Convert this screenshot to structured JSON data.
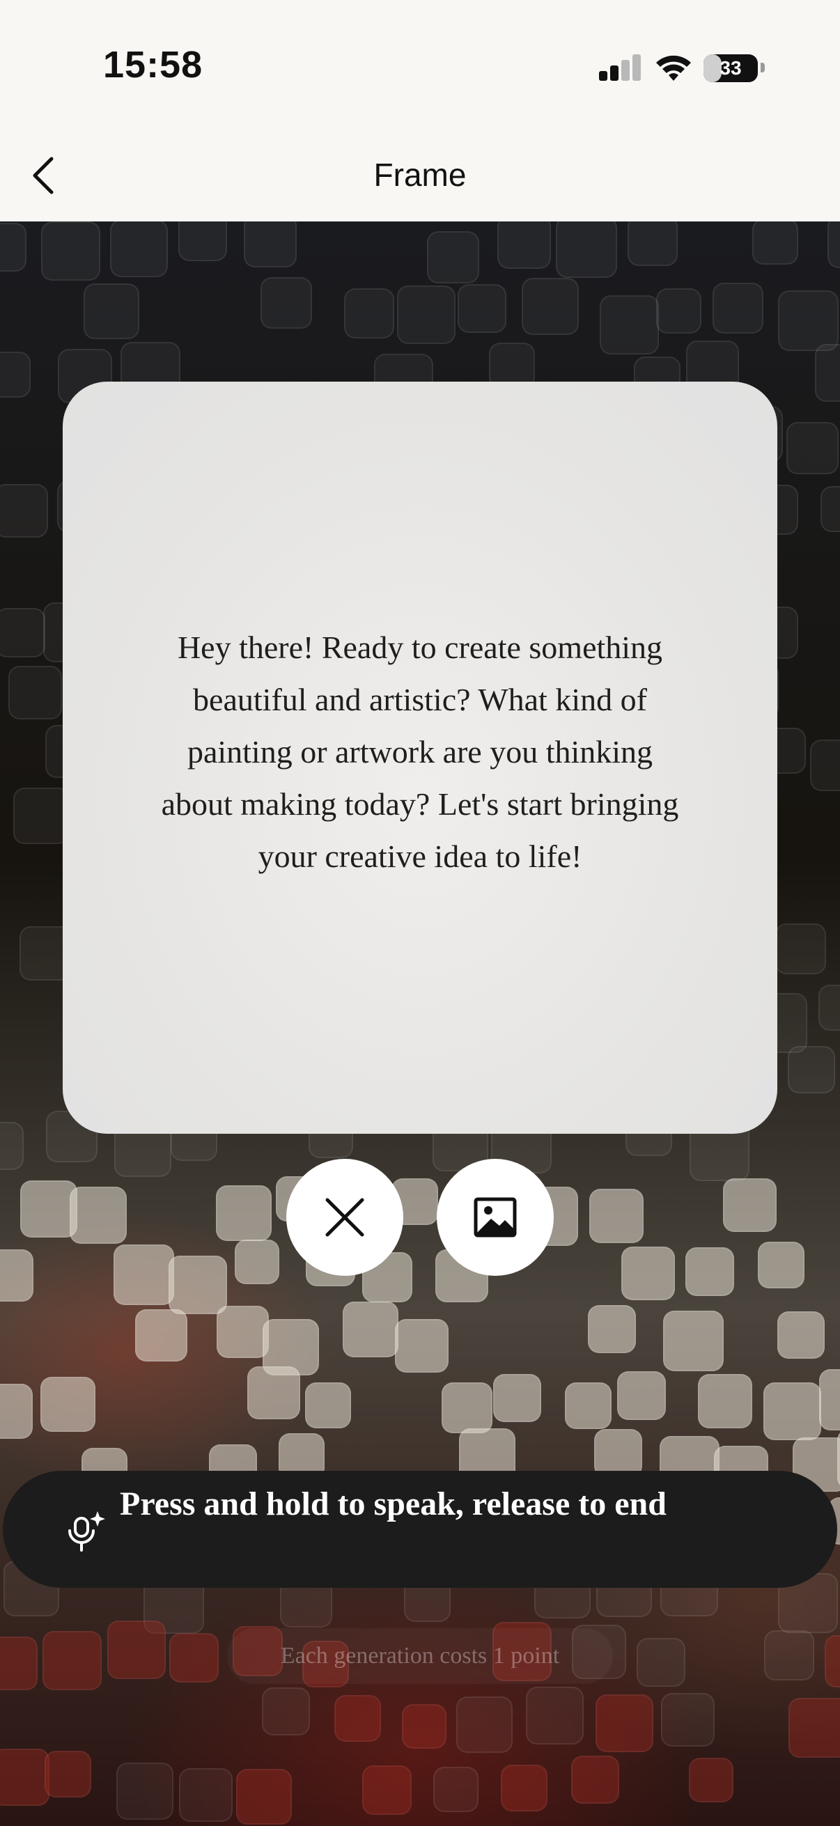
{
  "status_bar": {
    "time": "15:58",
    "battery": "33",
    "battery_percent": 33,
    "signal_bars": 2
  },
  "nav": {
    "title": "Frame",
    "back_icon": "chevron-left-icon"
  },
  "card": {
    "message": "Hey there! Ready to create something beautiful and artistic? What kind of painting or artwork are you thinking about making today? Let's start bringing your creative idea to life!"
  },
  "actions": {
    "close_icon": "close-icon",
    "image_icon": "image-icon"
  },
  "voice": {
    "label": "Press and hold to speak, release to end",
    "icon": "mic-sparkle-icon"
  },
  "footer": {
    "cost_note": "Each generation costs 1 point"
  },
  "colors": {
    "topbar_bg": "#f8f7f4",
    "card_bg": "#e6e5e3",
    "voice_bar_bg": "#1c1c1c"
  }
}
